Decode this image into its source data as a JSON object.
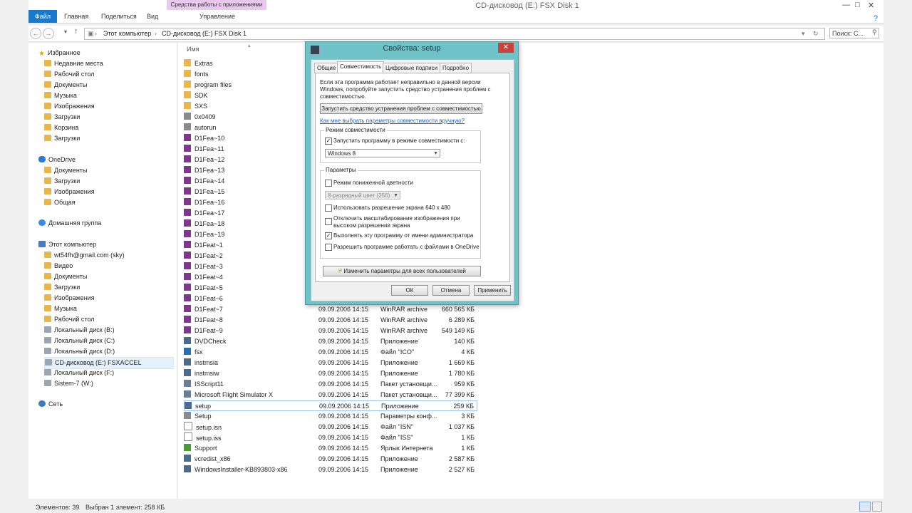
{
  "window": {
    "title": "CD-дисковод (E:) FSX Disk 1",
    "ribbon_tabs": [
      "Файл",
      "Главная",
      "Поделиться",
      "Вид",
      "Управление"
    ],
    "app_tools_band": "Средства работы с приложениями"
  },
  "address": {
    "crumbs": [
      "Этот компьютер",
      "CD-дисковод (E:) FSX Disk 1"
    ],
    "search_placeholder": "Поиск: С..."
  },
  "nav": {
    "favorites": "Избранное",
    "favorites_items": [
      "Недавние места",
      "Рабочий стол",
      "Документы",
      "Музыка",
      "Изображения",
      "Загрузки",
      "Корзина",
      "Загрузки"
    ],
    "onedrive": "OneDrive",
    "onedrive_items": [
      "Документы",
      "Загрузки",
      "Изображения",
      "Общая"
    ],
    "homegroup": "Домашняя группа",
    "thispc": "Этот компьютер",
    "thispc_items": [
      "wt54fh@gmail.com (sky)",
      "Видео",
      "Документы",
      "Загрузки",
      "Изображения",
      "Музыка",
      "Рабочий стол",
      "Локальный диск (B:)",
      "Локальный диск (C:)",
      "Локальный диск (D:)",
      "CD-дисковод (E:) FSXACCEL",
      "Локальный диск (F:)",
      "Sistem-7 (W:)"
    ],
    "network": "Сеть"
  },
  "filelist": {
    "name_header": "Имя",
    "files": [
      {
        "name": "Extras",
        "date": "",
        "type": "",
        "size": "",
        "icon": "folder"
      },
      {
        "name": "fonts",
        "date": "",
        "type": "",
        "size": "",
        "icon": "folder"
      },
      {
        "name": "program files",
        "date": "",
        "type": "",
        "size": "",
        "icon": "folder"
      },
      {
        "name": "SDK",
        "date": "",
        "type": "",
        "size": "",
        "icon": "folder"
      },
      {
        "name": "SXS",
        "date": "",
        "type": "",
        "size": "",
        "icon": "folder"
      },
      {
        "name": "0x0409",
        "date": "",
        "type": "",
        "size": "",
        "icon": "settings"
      },
      {
        "name": "autorun",
        "date": "",
        "type": "",
        "size": "",
        "icon": "settings"
      },
      {
        "name": "D1Fea~10",
        "date": "",
        "type": "",
        "size": "",
        "icon": "rar"
      },
      {
        "name": "D1Fea~11",
        "date": "",
        "type": "",
        "size": "",
        "icon": "rar"
      },
      {
        "name": "D1Fea~12",
        "date": "",
        "type": "",
        "size": "",
        "icon": "rar"
      },
      {
        "name": "D1Fea~13",
        "date": "",
        "type": "",
        "size": "",
        "icon": "rar"
      },
      {
        "name": "D1Fea~14",
        "date": "",
        "type": "",
        "size": "",
        "icon": "rar"
      },
      {
        "name": "D1Fea~15",
        "date": "",
        "type": "",
        "size": "",
        "icon": "rar"
      },
      {
        "name": "D1Fea~16",
        "date": "",
        "type": "",
        "size": "",
        "icon": "rar"
      },
      {
        "name": "D1Fea~17",
        "date": "",
        "type": "",
        "size": "",
        "icon": "rar"
      },
      {
        "name": "D1Fea~18",
        "date": "",
        "type": "",
        "size": "",
        "icon": "rar"
      },
      {
        "name": "D1Fea~19",
        "date": "",
        "type": "",
        "size": "",
        "icon": "rar"
      },
      {
        "name": "D1Feat~1",
        "date": "",
        "type": "",
        "size": "",
        "icon": "rar"
      },
      {
        "name": "D1Feat~2",
        "date": "",
        "type": "",
        "size": "",
        "icon": "rar"
      },
      {
        "name": "D1Feat~3",
        "date": "",
        "type": "",
        "size": "",
        "icon": "rar"
      },
      {
        "name": "D1Feat~4",
        "date": "",
        "type": "",
        "size": "",
        "icon": "rar"
      },
      {
        "name": "D1Feat~5",
        "date": "",
        "type": "",
        "size": "",
        "icon": "rar"
      },
      {
        "name": "D1Feat~6",
        "date": "",
        "type": "",
        "size": "",
        "icon": "rar"
      },
      {
        "name": "D1Feat~7",
        "date": "09.09.2006 14:15",
        "type": "WinRAR archive",
        "size": "660 565 КБ",
        "icon": "rar"
      },
      {
        "name": "D1Feat~8",
        "date": "09.09.2006 14:15",
        "type": "WinRAR archive",
        "size": "6 289 КБ",
        "icon": "rar"
      },
      {
        "name": "D1Feat~9",
        "date": "09.09.2006 14:15",
        "type": "WinRAR archive",
        "size": "549 149 КБ",
        "icon": "rar"
      },
      {
        "name": "DVDCheck",
        "date": "09.09.2006 14:15",
        "type": "Приложение",
        "size": "140 КБ",
        "icon": "app"
      },
      {
        "name": "fsx",
        "date": "09.09.2006 14:15",
        "type": "Файл \"ICO\"",
        "size": "4 КБ",
        "icon": "ico"
      },
      {
        "name": "instmsia",
        "date": "09.09.2006 14:15",
        "type": "Приложение",
        "size": "1 669 КБ",
        "icon": "app"
      },
      {
        "name": "instmsiw",
        "date": "09.09.2006 14:15",
        "type": "Приложение",
        "size": "1 780 КБ",
        "icon": "app"
      },
      {
        "name": "ISScript11",
        "date": "09.09.2006 14:15",
        "type": "Пакет установщи...",
        "size": "959 КБ",
        "icon": "msi"
      },
      {
        "name": "Microsoft Flight Simulator X",
        "date": "09.09.2006 14:15",
        "type": "Пакет установщи...",
        "size": "77 399 КБ",
        "icon": "msi"
      },
      {
        "name": "setup",
        "date": "09.09.2006 14:15",
        "type": "Приложение",
        "size": "259 КБ",
        "icon": "app",
        "selected": true
      },
      {
        "name": "Setup",
        "date": "09.09.2006 14:15",
        "type": "Параметры конф...",
        "size": "3 КБ",
        "icon": "settings"
      },
      {
        "name": "setup.isn",
        "date": "09.09.2006 14:15",
        "type": "Файл \"ISN\"",
        "size": "1 037 КБ",
        "icon": "file"
      },
      {
        "name": "setup.iss",
        "date": "09.09.2006 14:15",
        "type": "Файл \"ISS\"",
        "size": "1 КБ",
        "icon": "file"
      },
      {
        "name": "Support",
        "date": "09.09.2006 14:15",
        "type": "Ярлык Интернета",
        "size": "1 КБ",
        "icon": "link"
      },
      {
        "name": "vcredist_x86",
        "date": "09.09.2006 14:15",
        "type": "Приложение",
        "size": "2 587 КБ",
        "icon": "app"
      },
      {
        "name": "WindowsInstaller-KB893803-x86",
        "date": "09.09.2006 14:15",
        "type": "Приложение",
        "size": "2 527 КБ",
        "icon": "app"
      }
    ]
  },
  "status": {
    "count": "Элементов: 39",
    "selected": "Выбран 1 элемент: 258 КБ"
  },
  "dialog": {
    "title": "Свойства: setup",
    "tabs": [
      "Общие",
      "Совместимость",
      "Цифровые подписи",
      "Подробно"
    ],
    "intro": "Если эта программа работает неправильно в данной версии Windows, попробуйте запустить средство устранения проблем с совместимостью.",
    "troubleshoot_button": "Запустить средство устранения проблем с совместимостью",
    "manual_link": "Как мне выбрать параметры совместимости вручную?",
    "compat_group": "Режим совместимости",
    "compat_check": "Запустить программу в режиме совместимости с:",
    "compat_select": "Windows 8",
    "params_group": "Параметры",
    "reduced_color": "Режим пониженной цветности",
    "color_select": "8-разрядный цвет (256)",
    "res_640": "Использовать разрешение экрана 640 x 480",
    "dpi_scaling": "Отключить масштабирование изображения при высоком разрешении экрана",
    "run_admin": "Выполнять эту программу от имени администратора",
    "onedrive_files": "Разрешить программе работать с файлами в OneDrive",
    "all_users_button": "Изменить параметры для всех пользователей",
    "ok": "ОК",
    "cancel": "Отмена",
    "apply": "Применить"
  },
  "colors": {
    "accent": "#1979ca",
    "dialog_frame": "#6fc2c8",
    "close_red": "#c7433c",
    "folder": "#e8b64c",
    "link": "#2563b8"
  }
}
